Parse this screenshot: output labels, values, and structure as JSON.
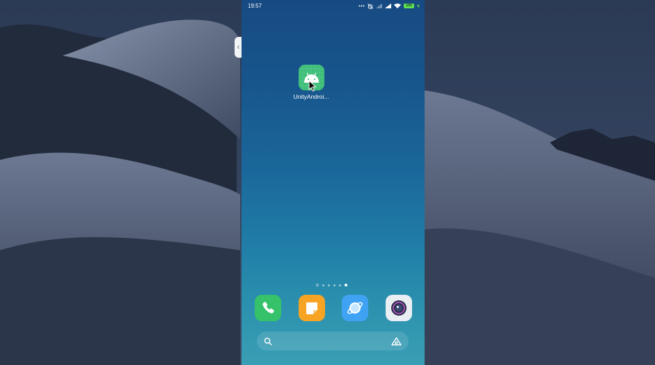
{
  "status_bar": {
    "time": "19:57",
    "battery_level": "100"
  },
  "home_screen": {
    "apps": [
      {
        "label": "UnityAndroi...",
        "icon": "android-icon"
      }
    ],
    "pager": {
      "page_count": 5,
      "active_page": 5
    }
  },
  "dock": {
    "apps": [
      {
        "name": "phone",
        "icon": "phone-icon",
        "color": "#35c26a"
      },
      {
        "name": "notes",
        "icon": "notes-icon",
        "color": "#f7a324"
      },
      {
        "name": "browser",
        "icon": "browser-icon",
        "color": "#3fa2f2"
      },
      {
        "name": "camera",
        "icon": "camera-icon",
        "color": "#e9eef3"
      }
    ]
  },
  "search_bar": {
    "left_icon": "search-icon",
    "right_icon": "assistant-icon"
  }
}
